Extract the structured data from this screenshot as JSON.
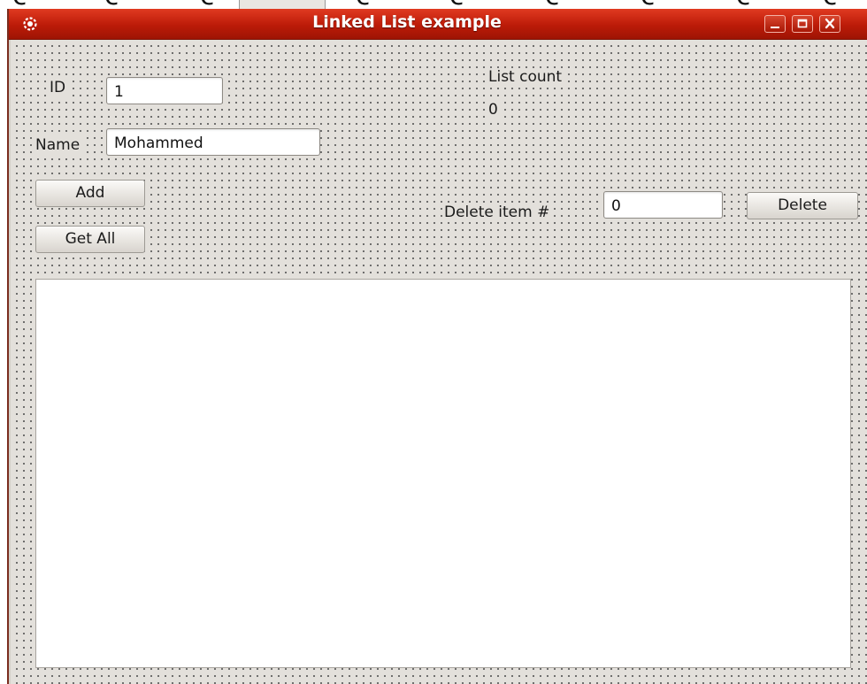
{
  "window": {
    "title": "Linked List example",
    "title_bar_color": "#bc1b08",
    "icon": "app-gear-icon",
    "controls": [
      "minimize-icon",
      "maximize-icon",
      "close-icon"
    ]
  },
  "form": {
    "id_label": "ID",
    "id_value": "1",
    "name_label": "Name",
    "name_value": "Mohammed",
    "add_label": "Add",
    "get_all_label": "Get All",
    "list_count_label": "List count",
    "list_count_value": "0",
    "delete_item_label": "Delete item #",
    "delete_item_value": "0",
    "delete_label": "Delete"
  },
  "list": {
    "items": []
  }
}
